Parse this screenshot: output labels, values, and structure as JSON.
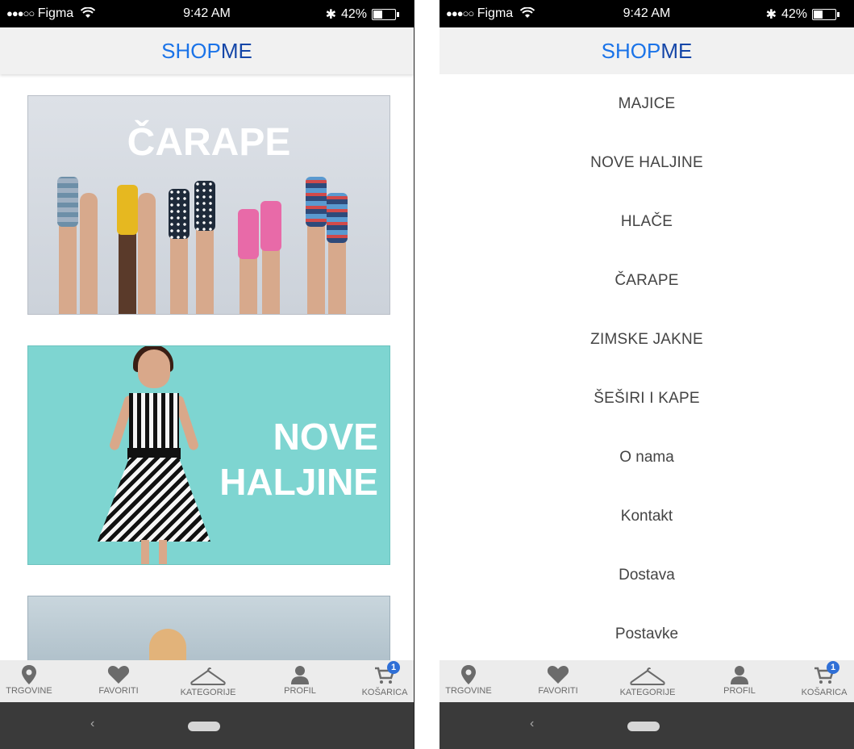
{
  "status_bar": {
    "signal_dots": "●●●○○",
    "carrier": "Figma",
    "time": "9:42 AM",
    "bluetooth": "✱",
    "battery_percent": "42%",
    "battery_level": 0.42
  },
  "header": {
    "brand_part1": "SHOP",
    "brand_part2": "ME"
  },
  "banners": [
    {
      "title": "ČARAPE"
    },
    {
      "title_line1": "NOVE",
      "title_line2": "HALJINE"
    }
  ],
  "menu": {
    "items": [
      {
        "label": "MAJICE"
      },
      {
        "label": "NOVE HALJINE"
      },
      {
        "label": "HLAČE"
      },
      {
        "label": "ČARAPE"
      },
      {
        "label": "ZIMSKE JAKNE"
      },
      {
        "label": "ŠEŠIRI I KAPE"
      },
      {
        "label": "O nama"
      },
      {
        "label": "Kontakt"
      },
      {
        "label": "Dostava"
      },
      {
        "label": "Postavke"
      }
    ]
  },
  "tabbar": {
    "tabs": [
      {
        "label": "TRGOVINE",
        "icon": "map-pin-icon"
      },
      {
        "label": "FAVORITI",
        "icon": "heart-icon"
      },
      {
        "label": "KATEGORIJE",
        "icon": "hanger-icon"
      },
      {
        "label": "PROFIL",
        "icon": "user-icon"
      },
      {
        "label": "KOŠARICA",
        "icon": "cart-icon"
      }
    ],
    "cart_badge": "1"
  },
  "nav_bar": {
    "back_glyph": "‹"
  },
  "colors": {
    "brand_light": "#1a73e8",
    "brand_dark": "#1546a8",
    "tab_icon": "#6b6b6b",
    "badge": "#2f6fd6",
    "socks_banner_bg": "#d6dbe2",
    "dress_banner_bg": "#7ed5d1"
  }
}
